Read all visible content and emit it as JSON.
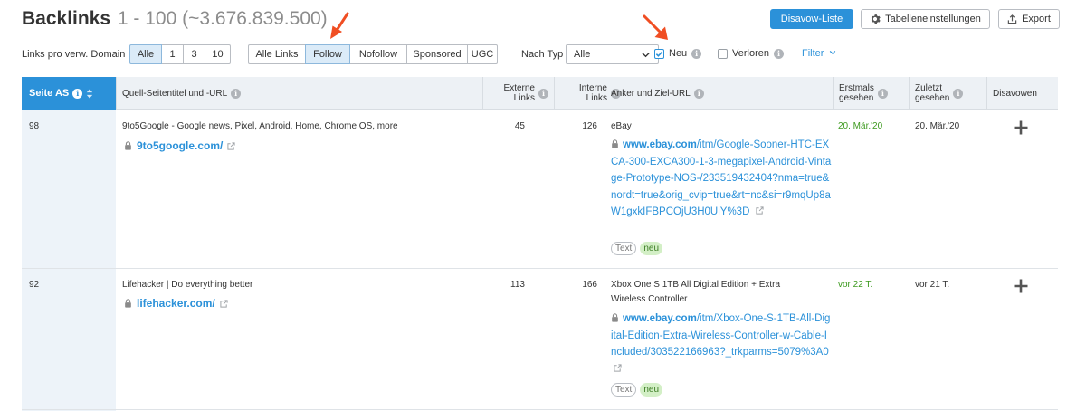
{
  "header": {
    "title": "Backlinks",
    "range": "1 - 100 (~3.676.839.500)",
    "disavow_list_label": "Disavow-Liste",
    "table_settings_label": "Tabelleneinstellungen",
    "export_label": "Export"
  },
  "filters": {
    "links_per_domain_label": "Links pro verw. Domain",
    "per_domain_options": [
      "Alle",
      "1",
      "3",
      "10"
    ],
    "per_domain_selected": "Alle",
    "link_type_options": [
      "Alle Links",
      "Follow",
      "Nofollow",
      "Sponsored",
      "UGC"
    ],
    "link_type_selected": "Follow",
    "by_type_label": "Nach Typ",
    "type_select_value": "Alle",
    "new_label": "Neu",
    "new_checked": true,
    "lost_label": "Verloren",
    "lost_checked": false,
    "filter_label": "Filter"
  },
  "table": {
    "columns": {
      "page_as": "Seite AS",
      "source": "Quell-Seitentitel und -URL",
      "external_links_1": "Externe",
      "external_links_2": "Links",
      "internal_links_1": "Interne",
      "internal_links_2": "Links",
      "anchor": "Anker und Ziel-URL",
      "first_seen_1": "Erstmals",
      "first_seen_2": "gesehen",
      "last_seen_1": "Zuletzt",
      "last_seen_2": "gesehen",
      "disavow": "Disavowen"
    },
    "rows": [
      {
        "page_as": "98",
        "source_title": "9to5Google - Google news, Pixel, Android, Home, Chrome OS, more",
        "source_domain": "9to5google.com/",
        "external_links": "45",
        "internal_links": "126",
        "anchor_text": "eBay",
        "target_domain": "www.ebay.com",
        "target_path": "/itm/Google-Sooner-HTC-EXCA-300-EXCA300-1-3-megapixel-Android-Vintage-Prototype-NOS-/233519432404?nma=true&nordt=true&orig_cvip=true&rt=nc&si=r9mqUp8aW1gxkIFBPCOjU3H0UiY%3D",
        "tag_text": "Text",
        "tag_new": "neu",
        "first_seen": "20. Mär.'20",
        "last_seen": "20. Mär.'20"
      },
      {
        "page_as": "92",
        "source_title": "Lifehacker | Do everything better",
        "source_domain": "lifehacker.com/",
        "external_links": "113",
        "internal_links": "166",
        "anchor_text_1": "Xbox One S 1TB All Digital Edition + Extra",
        "anchor_text_2": "Wireless Controller",
        "target_domain": "www.ebay.com",
        "target_path": "/itm/Xbox-One-S-1TB-All-Digital-Edition-Extra-Wireless-Controller-w-Cable-Included/303522166963?_trkparms=5079%3A0",
        "tag_text": "Text",
        "tag_new": "neu",
        "first_seen": "vor 22 T.",
        "last_seen": "vor 21 T."
      }
    ]
  },
  "colors": {
    "accent": "#2b91d9",
    "new_date": "#3d9a1f",
    "annotation_arrow": "#f04e23"
  },
  "icons": [
    "gear-icon",
    "export-icon",
    "info-icon",
    "sort-icon",
    "lock-icon",
    "external-link-icon",
    "plus-icon",
    "chevron-down-icon",
    "checkmark-icon",
    "arrow-annotation"
  ]
}
